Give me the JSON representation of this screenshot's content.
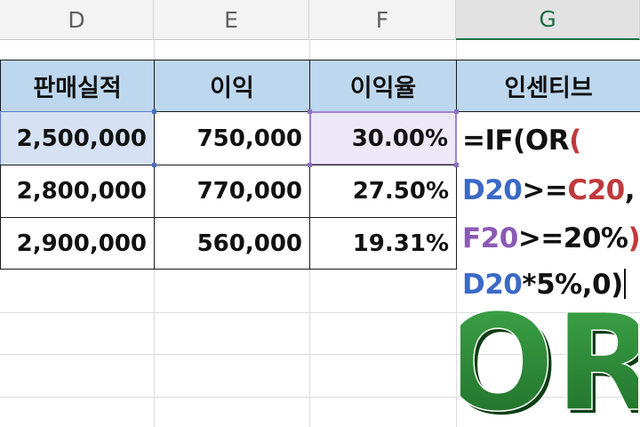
{
  "columns": [
    "D",
    "E",
    "F",
    "G"
  ],
  "selected_column": "G",
  "table": {
    "headers": [
      "판매실적",
      "이익",
      "이익율",
      "인센티브"
    ],
    "rows": [
      [
        "2,500,000",
        "750,000",
        "30.00%"
      ],
      [
        "2,800,000",
        "770,000",
        "27.50%"
      ],
      [
        "2,900,000",
        "560,000",
        "19.31%"
      ]
    ]
  },
  "formula": {
    "line1": {
      "a": "=IF(OR",
      "b": "("
    },
    "line2": {
      "a": "D20",
      "b": ">=",
      "c": "C20",
      "d": ","
    },
    "line3": {
      "a": "F20",
      "b": ">=20%",
      "c": ")",
      "d": ","
    },
    "line4": {
      "a": "D20",
      "b": "*5%,0)"
    }
  },
  "logo_text": "OR",
  "colors": {
    "header_fill": "#bdd7ee",
    "ref_blue": "#3b69c6",
    "ref_red": "#c0393d",
    "ref_purple": "#8b5ab5",
    "logo_green": "#2e8b3a"
  }
}
